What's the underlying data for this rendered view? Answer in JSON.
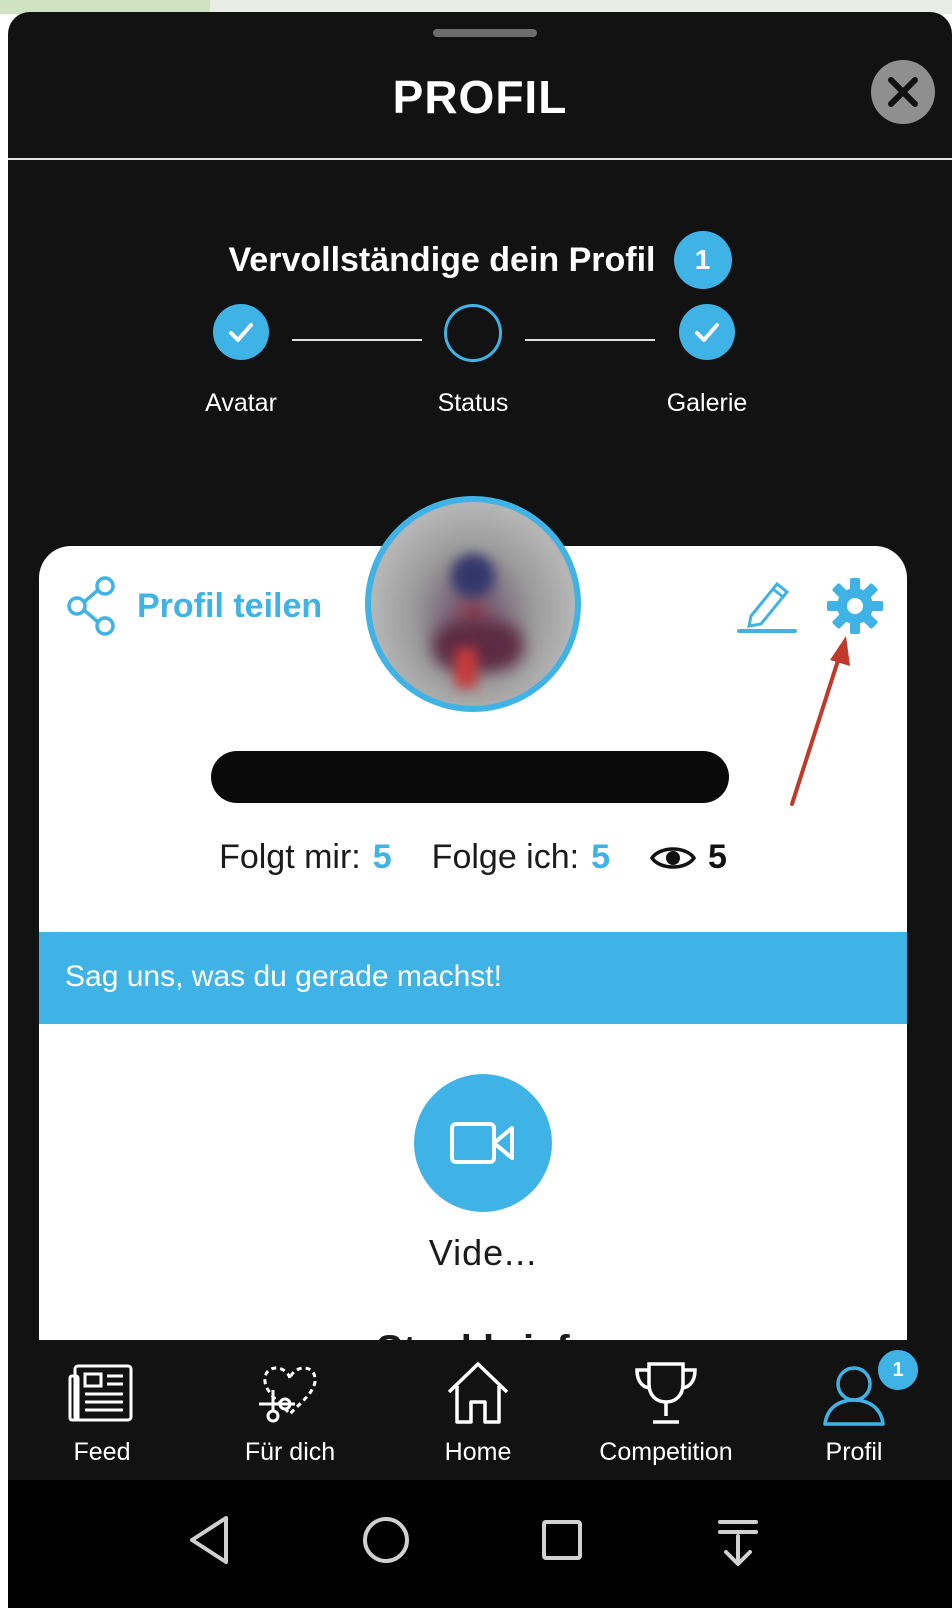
{
  "header": {
    "title": "PROFIL"
  },
  "completion": {
    "title": "Vervollständige dein Profil",
    "remaining_count": "1",
    "steps": [
      {
        "label": "Avatar",
        "done": true
      },
      {
        "label": "Status",
        "done": false
      },
      {
        "label": "Galerie",
        "done": true
      }
    ]
  },
  "card": {
    "share_label": "Profil teilen",
    "stats": {
      "followers_label": "Folgt mir:",
      "followers": "5",
      "following_label": "Folge ich:",
      "following": "5",
      "views": "5"
    },
    "status_placeholder": "Sag uns, was du gerade machst!",
    "video_label": "Vide...",
    "cut_heading": "Steckbrief"
  },
  "bottom_nav": [
    {
      "label": "Feed",
      "icon": "newspaper-icon"
    },
    {
      "label": "Für dich",
      "icon": "heart-scissors-icon"
    },
    {
      "label": "Home",
      "icon": "home-icon"
    },
    {
      "label": "Competition",
      "icon": "trophy-icon"
    },
    {
      "label": "Profil",
      "icon": "user-icon",
      "active": true,
      "badge": "1"
    }
  ],
  "colors": {
    "accent": "#3fb3e6",
    "background": "#121212",
    "arrow": "#c0392b"
  }
}
